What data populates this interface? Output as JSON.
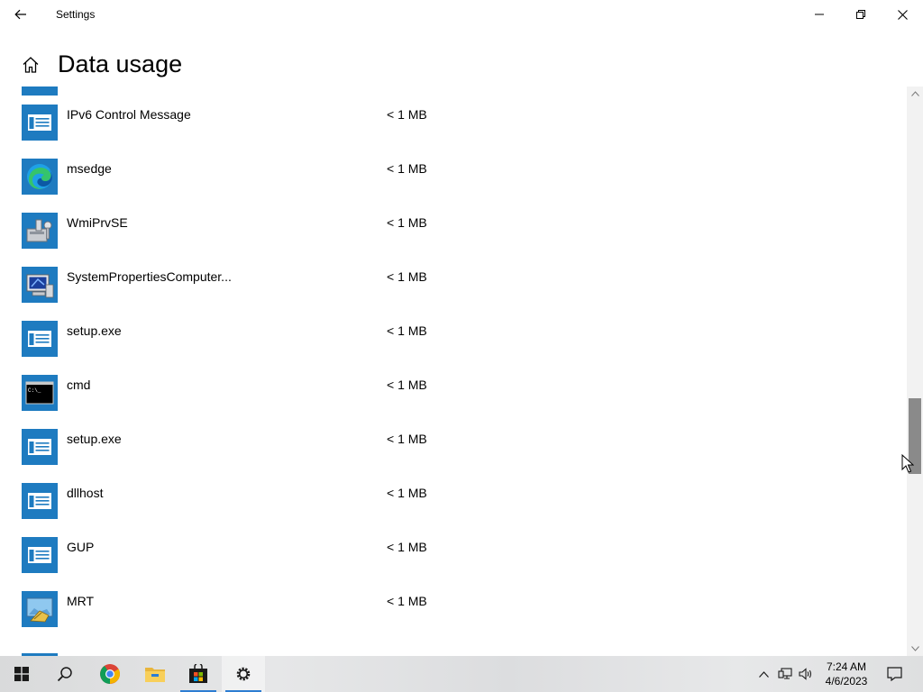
{
  "window": {
    "title": "Settings",
    "back_icon": "back-arrow-icon",
    "minimize_icon": "minimize-icon",
    "maximize_icon": "restore-icon",
    "close_icon": "close-icon"
  },
  "header": {
    "home_icon": "home-icon",
    "title": "Data usage"
  },
  "apps": [
    {
      "name": "IPv6 Control Message",
      "usage": "< 1 MB",
      "icon": "generic-app-icon"
    },
    {
      "name": "msedge",
      "usage": "< 1 MB",
      "icon": "edge-icon"
    },
    {
      "name": "WmiPrvSE",
      "usage": "< 1 MB",
      "icon": "wmi-provider-icon"
    },
    {
      "name": "SystemPropertiesComputer...",
      "usage": "< 1 MB",
      "icon": "system-properties-icon"
    },
    {
      "name": "setup.exe",
      "usage": "< 1 MB",
      "icon": "generic-app-icon"
    },
    {
      "name": "cmd",
      "usage": "< 1 MB",
      "icon": "cmd-icon"
    },
    {
      "name": "setup.exe",
      "usage": "< 1 MB",
      "icon": "generic-app-icon"
    },
    {
      "name": "dllhost",
      "usage": "< 1 MB",
      "icon": "generic-app-icon"
    },
    {
      "name": "GUP",
      "usage": "< 1 MB",
      "icon": "generic-app-icon"
    },
    {
      "name": "MRT",
      "usage": "< 1 MB",
      "icon": "mrt-icon"
    }
  ],
  "taskbar": {
    "items": [
      "start-icon",
      "search-icon",
      "chrome-icon",
      "file-explorer-icon",
      "store-icon",
      "settings-icon"
    ],
    "clock_time": "7:24 AM",
    "clock_date": "4/6/2023"
  },
  "colors": {
    "accent": "#1e7bc0",
    "taskbar_active": "#2d7dd2",
    "scroll_thumb": "#8a8a8a"
  }
}
